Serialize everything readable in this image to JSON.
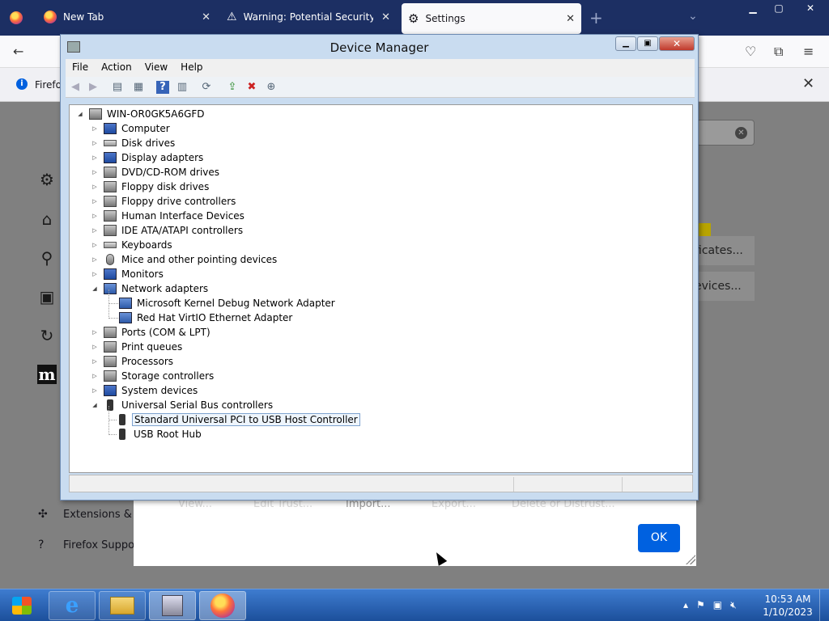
{
  "firefox": {
    "tabs": [
      {
        "title": "New Tab",
        "icon": "firefox-icon"
      },
      {
        "title": "Warning: Potential Security Risk",
        "icon": "warning-icon"
      },
      {
        "title": "Settings",
        "icon": "gear-icon"
      }
    ],
    "infobar_text": "Firefo",
    "sidebar_links": [
      {
        "label": "Extensions & T",
        "icon": "puzzle-icon"
      },
      {
        "label": "Firefox Suppor",
        "icon": "help-icon"
      }
    ],
    "bg_buttons": [
      "ficates...",
      "evices..."
    ],
    "dialog": {
      "ghost_buttons": [
        "View...",
        "Edit Trust...",
        "Import...",
        "Export...",
        "Delete or Distrust..."
      ],
      "ok_label": "OK"
    }
  },
  "device_manager": {
    "title": "Device Manager",
    "menu": [
      "File",
      "Action",
      "View",
      "Help"
    ],
    "root": "WIN-OR0GK5A6GFD",
    "categories": [
      {
        "label": "Computer"
      },
      {
        "label": "Disk drives"
      },
      {
        "label": "Display adapters"
      },
      {
        "label": "DVD/CD-ROM drives"
      },
      {
        "label": "Floppy disk drives"
      },
      {
        "label": "Floppy drive controllers"
      },
      {
        "label": "Human Interface Devices"
      },
      {
        "label": "IDE ATA/ATAPI controllers"
      },
      {
        "label": "Keyboards"
      },
      {
        "label": "Mice and other pointing devices"
      },
      {
        "label": "Monitors"
      },
      {
        "label": "Network adapters",
        "children": [
          "Microsoft Kernel Debug Network Adapter",
          "Red Hat VirtIO Ethernet Adapter"
        ]
      },
      {
        "label": "Ports (COM & LPT)"
      },
      {
        "label": "Print queues"
      },
      {
        "label": "Processors"
      },
      {
        "label": "Storage controllers"
      },
      {
        "label": "System devices"
      },
      {
        "label": "Universal Serial Bus controllers",
        "children": [
          "Standard Universal PCI to USB Host Controller",
          "USB Root Hub"
        ]
      }
    ],
    "selected": "Standard Universal PCI to USB Host Controller"
  },
  "taskbar": {
    "time": "10:53 AM",
    "date": "1/10/2023"
  }
}
